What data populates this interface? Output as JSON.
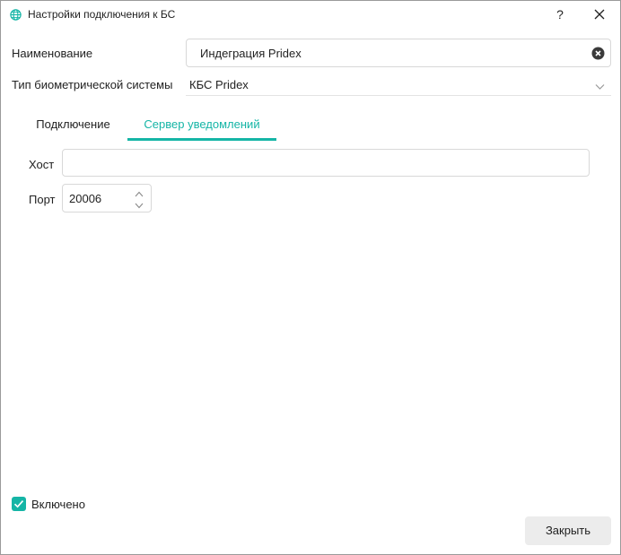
{
  "window": {
    "title": "Настройки подключения к БС",
    "help_label": "?",
    "title_icon": "globe-icon",
    "close_icon": "close-icon"
  },
  "form": {
    "name_label": "Наименование",
    "name_value": "Индеграция Pridex",
    "biometric_type_label": "Тип биометрической системы",
    "biometric_type_value": "КБС Pridex"
  },
  "tabs": [
    {
      "label": "Подключение",
      "active": false
    },
    {
      "label": "Сервер уведомлений",
      "active": true
    }
  ],
  "notification_server": {
    "host_label": "Хост",
    "host_value": "",
    "port_label": "Порт",
    "port_value": "20006"
  },
  "footer": {
    "enabled_label": "Включено",
    "enabled_checked": true,
    "close_button_label": "Закрыть"
  },
  "colors": {
    "accent": "#15b5a6",
    "border": "#d8d8d8",
    "button_bg": "#ececec"
  }
}
